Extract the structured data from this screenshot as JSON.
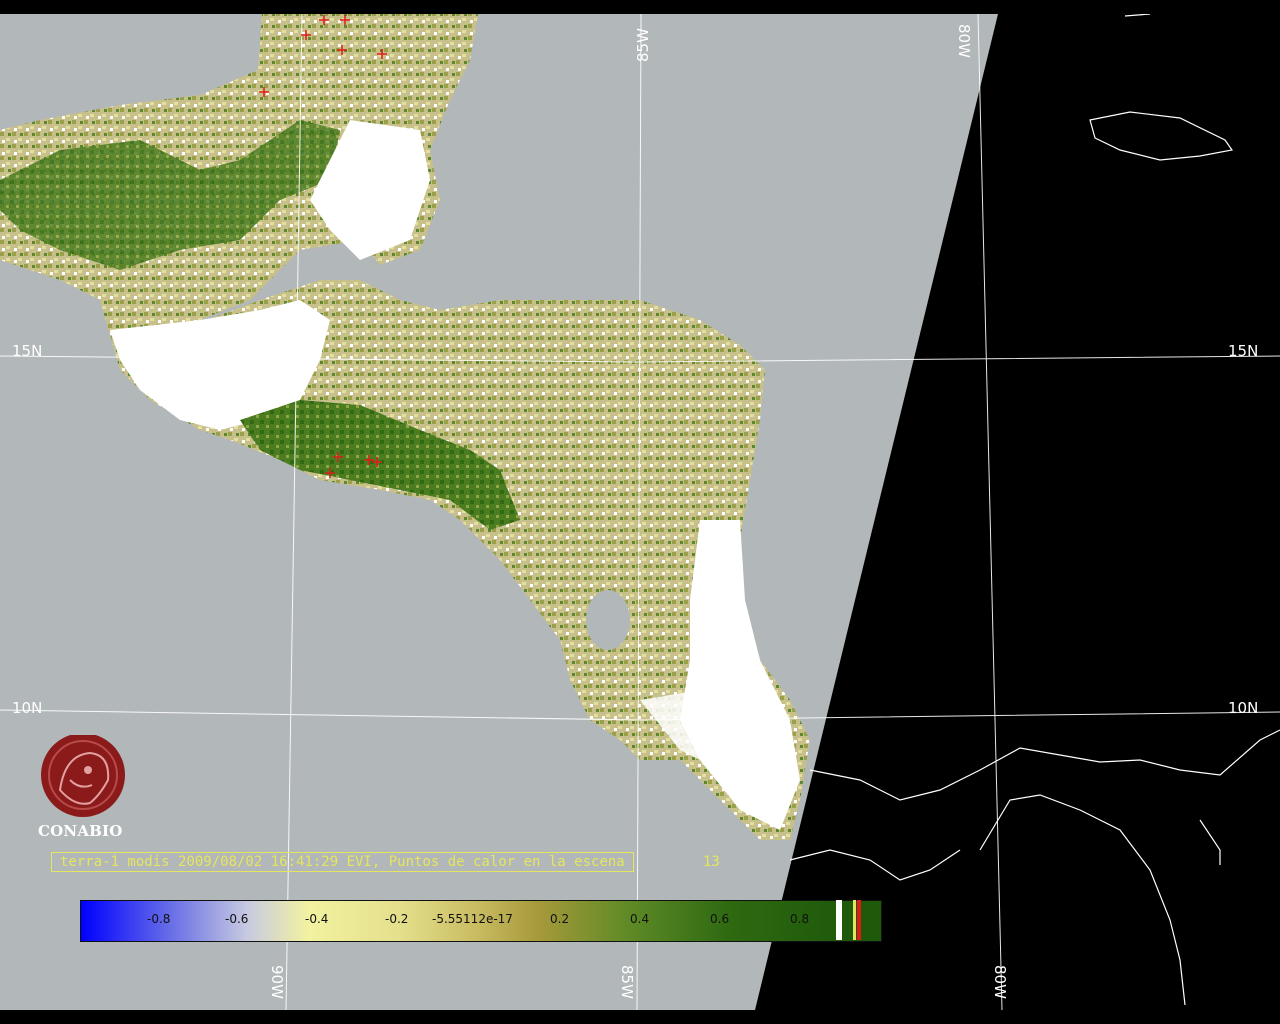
{
  "map": {
    "title": "terra-1 modis 2009/08/02 16:41:29 EVI, Puntos de calor en la escena",
    "fire_count": "13",
    "logo_label": "CONABIO",
    "latitude_labels_left": [
      "15N",
      "10N"
    ],
    "latitude_labels_right": [
      "15N",
      "10N"
    ],
    "longitude_labels_top": [
      "85W",
      "80W"
    ],
    "longitude_labels_bottom": [
      "90W",
      "85W",
      "80W"
    ],
    "colors": {
      "no_data_background": "#000000",
      "swath_gray": "#b2b7b9",
      "cloud_white": "#ffffff",
      "coastline": "#ffffff",
      "hotspot": "#e11b1b",
      "caption": "#e6e65c"
    }
  },
  "legend": {
    "tick_labels": [
      "-0.8",
      "-0.6",
      "-0.4",
      "-0.2",
      "-5.55112e-17",
      "0.2",
      "0.4",
      "0.6",
      "0.8"
    ],
    "extra_swatches": [
      "white",
      "black",
      "yellow",
      "red",
      "black",
      "green"
    ]
  }
}
